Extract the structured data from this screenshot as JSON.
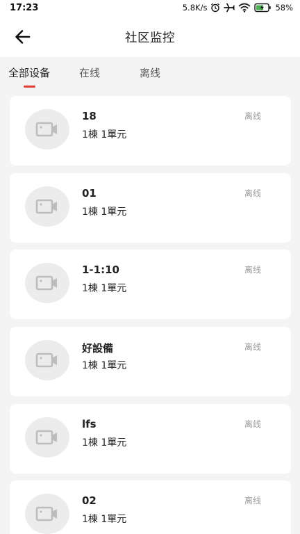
{
  "status_bar": {
    "time": "17:23",
    "net_speed": "5.8K/s",
    "battery": "58%",
    "icons": [
      "alarm-icon",
      "airplane-icon",
      "wifi-icon",
      "battery-icon"
    ]
  },
  "header": {
    "title": "社区监控",
    "back_icon": "back-arrow-icon"
  },
  "tabs": [
    {
      "label": "全部设备",
      "active": true
    },
    {
      "label": "在线",
      "active": false
    },
    {
      "label": "离线",
      "active": false
    }
  ],
  "colors": {
    "accent": "#e53935",
    "card_bg": "#ffffff",
    "page_bg": "#f4f4f4",
    "thumb_bg": "#ececec",
    "icon_gray": "#bdbdbd",
    "status_gray": "#999999"
  },
  "cameras": [
    {
      "name": "18",
      "location": "1棟 1單元",
      "status": "离线",
      "icon": "camera-icon"
    },
    {
      "name": "01",
      "location": "1棟 1單元",
      "status": "离线",
      "icon": "camera-icon"
    },
    {
      "name": "1-1:10",
      "location": "1棟 1單元",
      "status": "离线",
      "icon": "camera-icon"
    },
    {
      "name": "好設備",
      "location": "1棟 1單元",
      "status": "离线",
      "icon": "camera-icon"
    },
    {
      "name": "lfs",
      "location": "1棟 1單元",
      "status": "离线",
      "icon": "camera-icon"
    },
    {
      "name": "02",
      "location": "1棟 1單元",
      "status": "离线",
      "icon": "camera-icon"
    }
  ]
}
